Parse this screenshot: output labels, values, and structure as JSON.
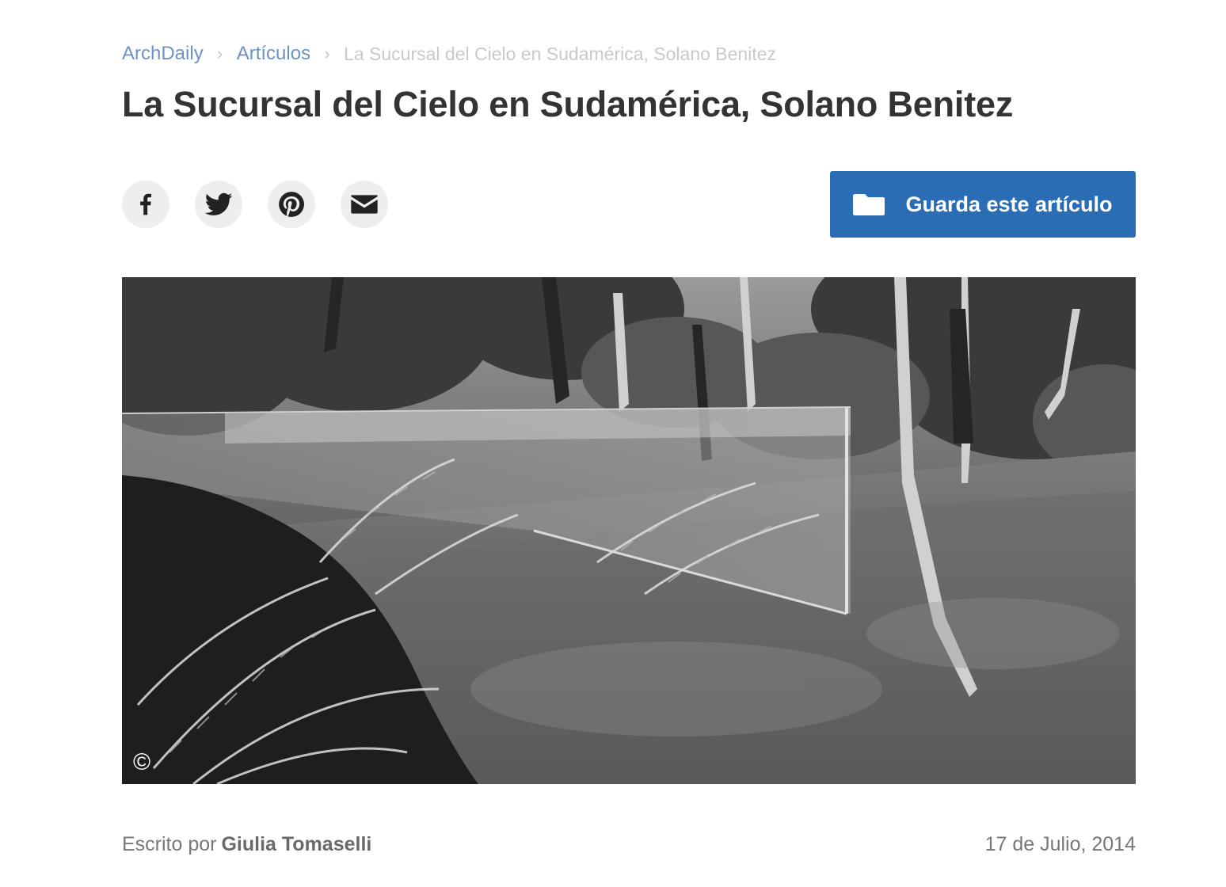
{
  "breadcrumb": {
    "items": [
      "ArchDaily",
      "Artículos"
    ],
    "separator": "›",
    "current": "La Sucursal del Cielo en Sudamérica, Solano Benitez"
  },
  "article": {
    "title": "La Sucursal del Cielo en Sudamérica, Solano Benitez",
    "image_credit": "©",
    "byline_prefix": "Escrito por",
    "author": "Giulia Tomaselli",
    "date": "17 de Julio, 2014"
  },
  "share": {
    "icons": [
      "facebook-icon",
      "twitter-icon",
      "pinterest-icon",
      "email-icon"
    ]
  },
  "save_button": {
    "label": "Guarda este artículo",
    "icon": "folder-icon"
  },
  "colors": {
    "accent": "#2a6db5",
    "link": "#6b93c4",
    "title": "#333333"
  }
}
